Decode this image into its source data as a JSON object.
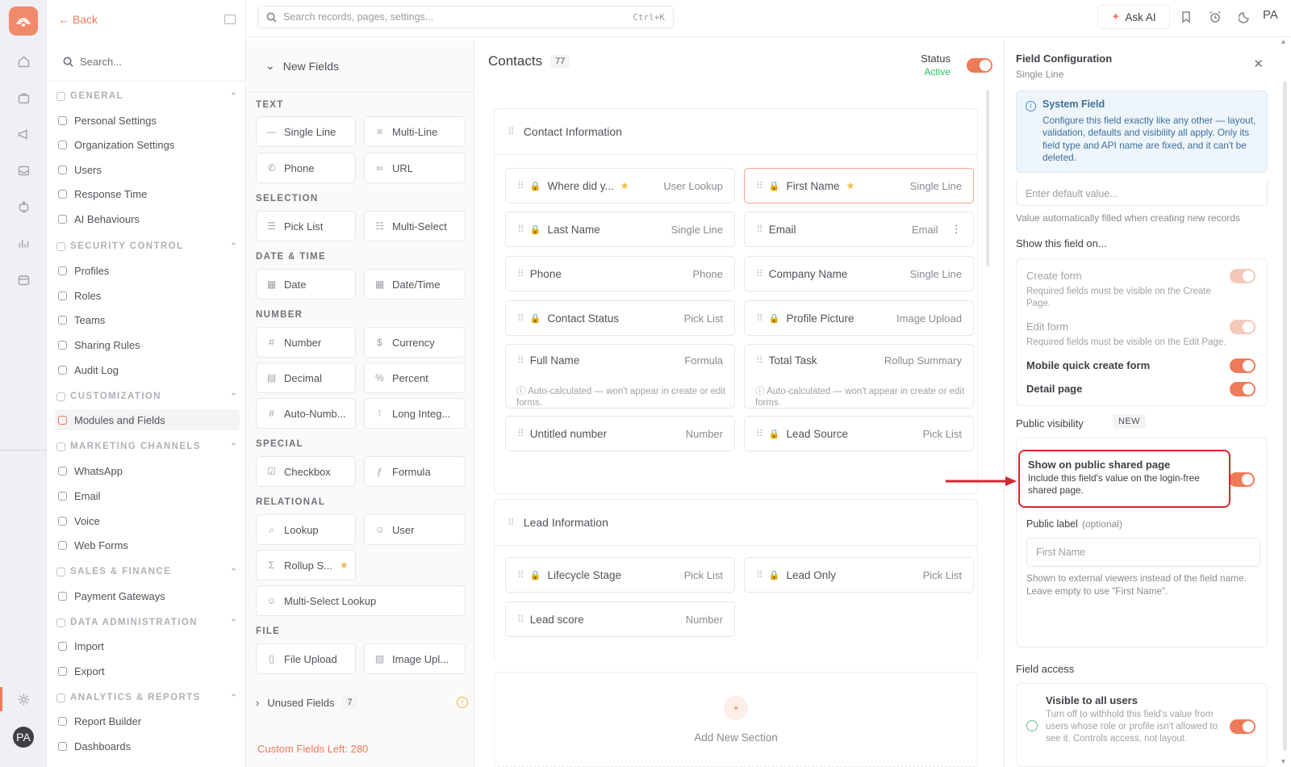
{
  "brand": {
    "accent": "#ef7a5a",
    "highlight": "#d3282f"
  },
  "rail": {
    "icons": [
      "home-icon",
      "briefcase-icon",
      "megaphone-icon",
      "inbox-icon",
      "robot-icon",
      "chart-icon",
      "calendar-icon",
      "settings-icon"
    ],
    "avatar": "PA"
  },
  "sidebar": {
    "back": "Back",
    "search_placeholder": "Search...",
    "groups": [
      {
        "label": "GENERAL",
        "items": [
          "Personal Settings",
          "Organization Settings",
          "Users",
          "Response Time",
          "AI Behaviours"
        ]
      },
      {
        "label": "SECURITY CONTROL",
        "items": [
          "Profiles",
          "Roles",
          "Teams",
          "Sharing Rules",
          "Audit Log"
        ]
      },
      {
        "label": "CUSTOMIZATION",
        "items": [
          "Modules and Fields"
        ]
      },
      {
        "label": "MARKETING CHANNELS",
        "items": [
          "WhatsApp",
          "Email",
          "Voice",
          "Web Forms"
        ]
      },
      {
        "label": "SALES & FINANCE",
        "items": [
          "Payment Gateways"
        ]
      },
      {
        "label": "DATA ADMINISTRATION",
        "items": [
          "Import",
          "Export"
        ]
      },
      {
        "label": "ANALYTICS & REPORTS",
        "items": [
          "Report Builder",
          "Dashboards"
        ]
      }
    ]
  },
  "topbar": {
    "search_placeholder": "Search records, pages, settings...",
    "shortcut": "Ctrl+K",
    "ask_ai": "Ask AI",
    "avatar": "PA"
  },
  "fields": {
    "title": "New Fields",
    "categories": {
      "text": "TEXT",
      "selection": "SELECTION",
      "datetime": "DATE & TIME",
      "number": "NUMBER",
      "special": "SPECIAL",
      "relational": "RELATIONAL",
      "file": "FILE"
    },
    "items": {
      "single_line": "Single Line",
      "multi_line": "Multi-Line",
      "phone": "Phone",
      "url": "URL",
      "pick_list": "Pick List",
      "multi_select": "Multi-Select",
      "date": "Date",
      "date_time": "Date/Time",
      "number": "Number",
      "currency": "Currency",
      "decimal": "Decimal",
      "percent": "Percent",
      "auto_number": "Auto-Numb...",
      "long_integer": "Long Integ...",
      "checkbox": "Checkbox",
      "formula": "Formula",
      "lookup": "Lookup",
      "user": "User",
      "rollup": "Rollup S...",
      "multi_select_lookup": "Multi-Select Lookup",
      "file_upload": "File Upload",
      "image_upload": "Image Upl..."
    },
    "unused_label": "Unused Fields",
    "unused_count": "7",
    "custom_left": "Custom Fields Left: 280"
  },
  "canvas": {
    "title": "Contacts",
    "count": "77",
    "status_label": "Status",
    "status_value": "Active",
    "contact_section": "Contact Information",
    "lead_section": "Lead Information",
    "cards": {
      "c1_name": "Where did y...",
      "c1_type": "User Lookup",
      "c2_name": "First Name",
      "c2_type": "Single Line",
      "c3_name": "Last Name",
      "c3_type": "Single Line",
      "c4_name": "Email",
      "c4_type": "Email",
      "c5_name": "Phone",
      "c5_type": "Phone",
      "c6_name": "Company Name",
      "c6_type": "Single Line",
      "c7_name": "Contact Status",
      "c7_type": "Pick List",
      "c8_name": "Profile Picture",
      "c8_type": "Image Upload",
      "c9_name": "Full Name",
      "c9_type": "Formula",
      "c10_name": "Total Task",
      "c10_type": "Rollup Summary",
      "c11_name": "Untitled number",
      "c11_type": "Number",
      "c12_name": "Lead Source",
      "c12_type": "Pick List",
      "l1_name": "Lifecycle Stage",
      "l1_type": "Pick List",
      "l2_name": "Lead Only",
      "l2_type": "Pick List",
      "l3_name": "Lead score",
      "l3_type": "Number"
    },
    "auto_note": "Auto-calculated — won't appear in create or edit forms.",
    "add_section": "Add New Section"
  },
  "panel": {
    "title": "Field Configuration",
    "subtitle": "Single Line",
    "sys_title": "System Field",
    "sys_body": "Configure this field exactly like any other — layout, validation, defaults and visibility all apply. Only its field type and API name are fixed, and it can't be deleted.",
    "default_placeholder": "Enter default value...",
    "default_help": "Value automatically filled when creating new records",
    "show_on": "Show this field on...",
    "create_form": "Create form",
    "create_desc": "Required fields must be visible on the Create Page.",
    "edit_form": "Edit form",
    "edit_desc": "Required fields must be visible on the Edit Page.",
    "mobile_form": "Mobile quick create form",
    "detail_page": "Detail page",
    "public_vis": "Public visibility",
    "new_badge": "NEW",
    "public_title": "Show on public shared page",
    "public_desc": "Include this field's value on the login-free shared page.",
    "public_label": "Public label",
    "public_label_opt": "(optional)",
    "public_placeholder": "First Name",
    "public_help": "Shown to external viewers instead of the field name. Leave empty to use \"First Name\".",
    "field_access": "Field access",
    "visible_title": "Visible to all users",
    "visible_desc": "Turn off to withhold this field's value from users whose role or profile isn't allowed to see it. Controls access, not layout."
  }
}
